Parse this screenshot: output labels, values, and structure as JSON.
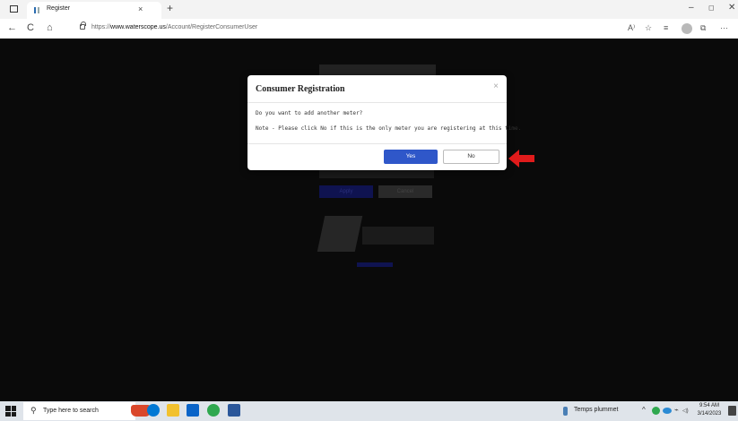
{
  "browser": {
    "tab_title": "Register",
    "tab_close": "×",
    "new_tab": "+",
    "url_prefix": "https://",
    "url_domain": "www.waterscope.us",
    "url_path": "/Account/RegisterConsumerUser",
    "window_controls": {
      "minimize": "–",
      "maximize": "◻",
      "close": "✕"
    },
    "nav": {
      "back": "←",
      "refresh": "C",
      "home": "⌂"
    },
    "toolbar_icons": [
      "read-aloud-icon",
      "favorites-add-icon",
      "favorites-icon",
      "collections-icon",
      "profile-icon",
      "more-icon"
    ],
    "toolbar_glyphs": {
      "read_aloud": "A⁾",
      "favorite_add": "☆",
      "favorites": "≡",
      "collections": "⧉",
      "more": "···"
    }
  },
  "background_page": {
    "apply_label": "Apply",
    "cancel_label": "Cancel"
  },
  "modal": {
    "title": "Consumer Registration",
    "close": "×",
    "question": "Do you want to add another meter?",
    "note": "Note - Please click No if this is the only meter you are registering at this time.",
    "yes_label": "Yes",
    "no_label": "No",
    "yes_color": "#2f57c9"
  },
  "annotation": {
    "arrow_color": "#e01b1b",
    "points_to": "No"
  },
  "taskbar": {
    "search_placeholder": "Type here to search",
    "search_glyph": "⚲",
    "apps": [
      {
        "name": "cortana-icon",
        "color": "#0078d4"
      },
      {
        "name": "file-explorer-icon",
        "color": "#f2c12e"
      },
      {
        "name": "outlook-icon",
        "color": "#0a64c8"
      },
      {
        "name": "chrome-icon",
        "color": "#2fa84f"
      },
      {
        "name": "word-icon",
        "color": "#2b579a"
      }
    ],
    "weather_text": "Temps plummet",
    "tray_glyphs": {
      "chevron": "^",
      "network": "⌁",
      "volume": "◁)"
    },
    "clock_time": "9:54 AM",
    "clock_date": "3/14/2023"
  }
}
